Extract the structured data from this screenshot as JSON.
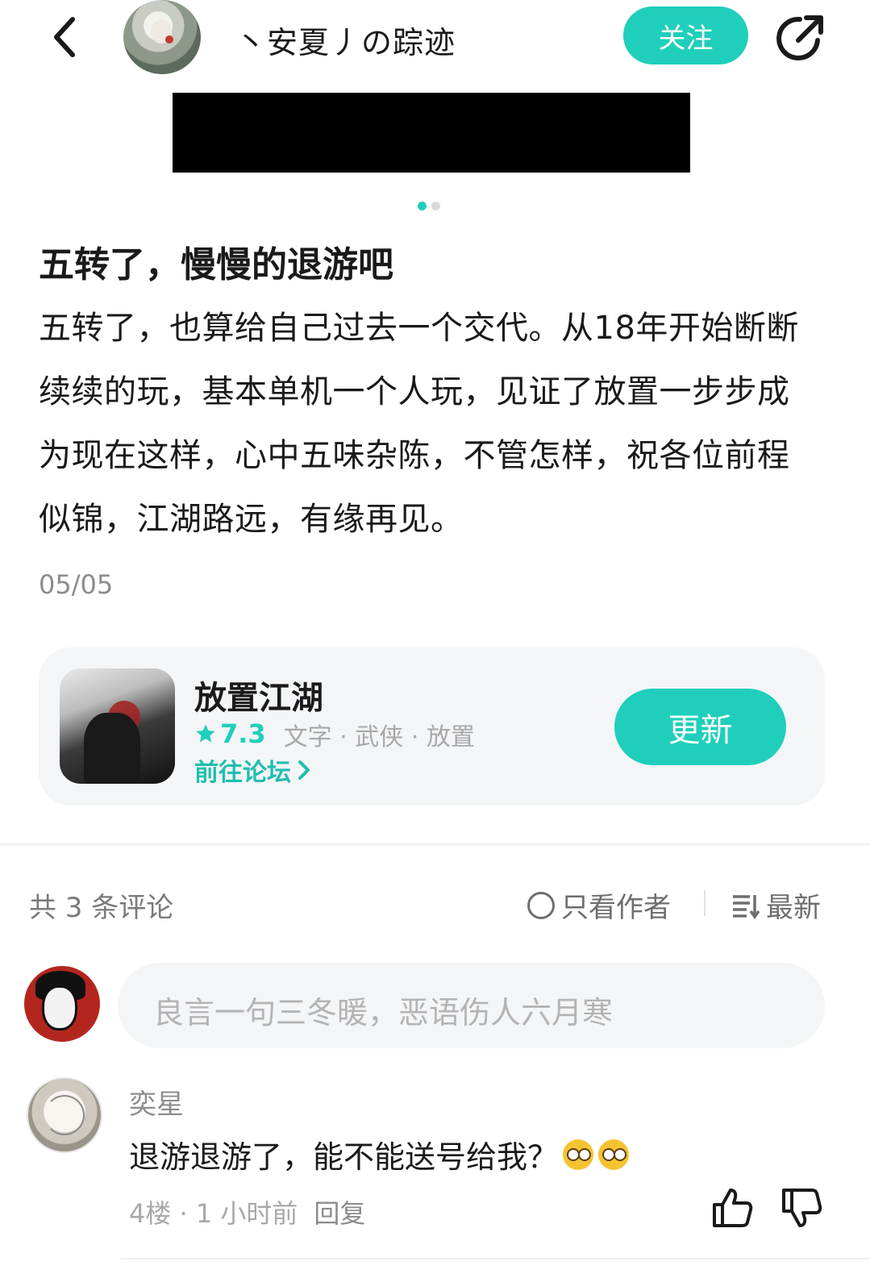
{
  "header": {
    "author_name": "丶安夏丿の踪迹",
    "follow_label": "关注"
  },
  "carousel": {
    "page_count": 2,
    "active_index": 0
  },
  "post": {
    "title": "五转了，慢慢的退游吧",
    "body": "五转了，也算给自己过去一个交代。从18年开始断断续续的玩，基本单机一个人玩，见证了放置一步步成为现在这样，心中五味杂陈，不管怎样，祝各位前程似锦，江湖路远，有缘再见。",
    "date": "05/05"
  },
  "game": {
    "name": "放置江湖",
    "rating": "7.3",
    "tags": "文字 · 武侠 · 放置",
    "forum_label": "前往论坛",
    "update_label": "更新"
  },
  "comments_section": {
    "count_label": "共 3 条评论",
    "author_only_label": "只看作者",
    "sort_label": "最新",
    "input_placeholder": "良言一句三冬暖，恶语伤人六月寒"
  },
  "comments": [
    {
      "user": "奕星",
      "text": "退游退游了，能不能送号给我？",
      "floor_time": "4楼 · 1 小时前",
      "reply_label": "回复"
    }
  ],
  "colors": {
    "accent": "#1fcfbb",
    "text": "#1a1a1a",
    "muted": "#8c8c8c",
    "card_bg": "#f4f5f7"
  }
}
